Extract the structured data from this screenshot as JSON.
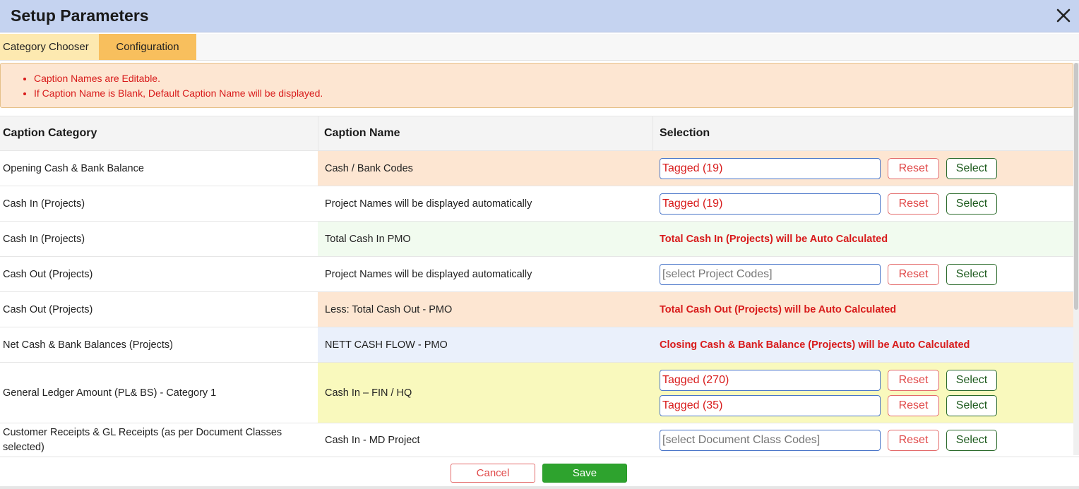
{
  "window": {
    "title": "Setup Parameters",
    "close_icon": "close-icon"
  },
  "tabs": [
    {
      "label": "Category Chooser",
      "active": false
    },
    {
      "label": "Configuration",
      "active": true
    }
  ],
  "notice": {
    "items": [
      "Caption Names are Editable.",
      "If Caption Name is Blank, Default Caption Name will be displayed."
    ]
  },
  "table": {
    "headers": [
      "Caption Category",
      "Caption Name",
      "Selection"
    ],
    "rows": [
      {
        "category": "Opening Cash & Bank Balance",
        "caption": "Cash / Bank Codes",
        "field_value": "Tagged (19)"
      },
      {
        "category": "Cash In (Projects)",
        "caption": "Project Names will be displayed automatically",
        "field_value": "Tagged (19)"
      },
      {
        "category": "Cash In (Projects)",
        "caption": "Total Cash In PMO",
        "auto_text": "Total Cash In (Projects) will be Auto Calculated"
      },
      {
        "category": "Cash Out (Projects)",
        "caption": "Project Names will be displayed automatically",
        "field_placeholder": "[select Project Codes]"
      },
      {
        "category": "Cash Out (Projects)",
        "caption": "Less: Total Cash Out - PMO",
        "auto_text": "Total Cash Out (Projects) will be Auto Calculated"
      },
      {
        "category": "Net Cash & Bank Balances (Projects)",
        "caption": "NETT CASH FLOW - PMO",
        "auto_text": "Closing Cash & Bank Balance (Projects) will be Auto Calculated"
      },
      {
        "category": "General Ledger Amount (PL& BS) - Category 1",
        "caption": "Cash In – FIN / HQ",
        "field_value": "Tagged (270)",
        "field_value_2": "Tagged (35)"
      },
      {
        "category": "Customer Receipts & GL Receipts (as per Document Classes selected)",
        "caption": "Cash In - MD Project",
        "field_placeholder": "[select Document Class Codes]"
      }
    ],
    "reset_label": "Reset",
    "select_label": "Select"
  },
  "footer": {
    "cancel_label": "Cancel",
    "save_label": "Save"
  },
  "colors": {
    "titlebar": "#c5d3f0",
    "active_tab": "#f8bf5d",
    "notice_bg": "#fde6d2",
    "notice_text": "#d81b1b",
    "save_button": "#2ea32e"
  }
}
